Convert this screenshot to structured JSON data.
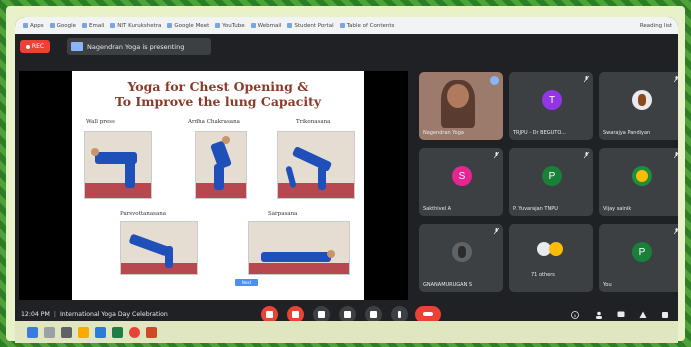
{
  "browser": {
    "bookmarks": [
      {
        "label": "Apps"
      },
      {
        "label": "Google"
      },
      {
        "label": "Email"
      },
      {
        "label": "NIT Kurukshetra"
      },
      {
        "label": "Google Meet"
      },
      {
        "label": "YouTube"
      },
      {
        "label": "Webmail"
      },
      {
        "label": "Student Portal"
      },
      {
        "label": "Table of Contents"
      }
    ],
    "reading_list": "Reading list"
  },
  "meet": {
    "rec_label": "REC",
    "presenting_text": "Nagendran Yoga is presenting",
    "slide": {
      "title_line1": "Yoga for Chest Opening &",
      "title_line2": "To Improve the lung Capacity",
      "pose_labels": [
        "Wall press",
        "Ardha Chakrasana",
        "Trikonasana",
        "Parsvottanasana",
        "Sarpasana"
      ],
      "button_label": "Next"
    },
    "participants": [
      {
        "name": "Nagendran Yoga",
        "initial": "",
        "color": "#9c7b6c",
        "type": "camera"
      },
      {
        "name": "TRJPU - Dr BEGUTO...",
        "initial": "T",
        "color": "#9334e6",
        "type": "avatar"
      },
      {
        "name": "Swarajya Pandiyan",
        "initial": "",
        "color": "#e8eaed",
        "type": "photo"
      },
      {
        "name": "Sakthivel A",
        "initial": "S",
        "color": "#e52592",
        "type": "avatar"
      },
      {
        "name": "P. Yuvarajan TNPU",
        "initial": "P",
        "color": "#188038",
        "type": "avatar"
      },
      {
        "name": "Vijay sainik",
        "initial": "",
        "color": "#1e8e3e",
        "type": "emoji"
      },
      {
        "name": "GNANAMURUGAN S",
        "initial": "",
        "color": "#5f6368",
        "type": "photo"
      },
      {
        "name": "71 others",
        "initial": "",
        "color": "#3c4043",
        "type": "others"
      },
      {
        "name": "You",
        "initial": "P",
        "color": "#188038",
        "type": "avatar"
      }
    ],
    "time": "12:04 PM",
    "meeting_title": "International Yoga Day Celebration"
  }
}
